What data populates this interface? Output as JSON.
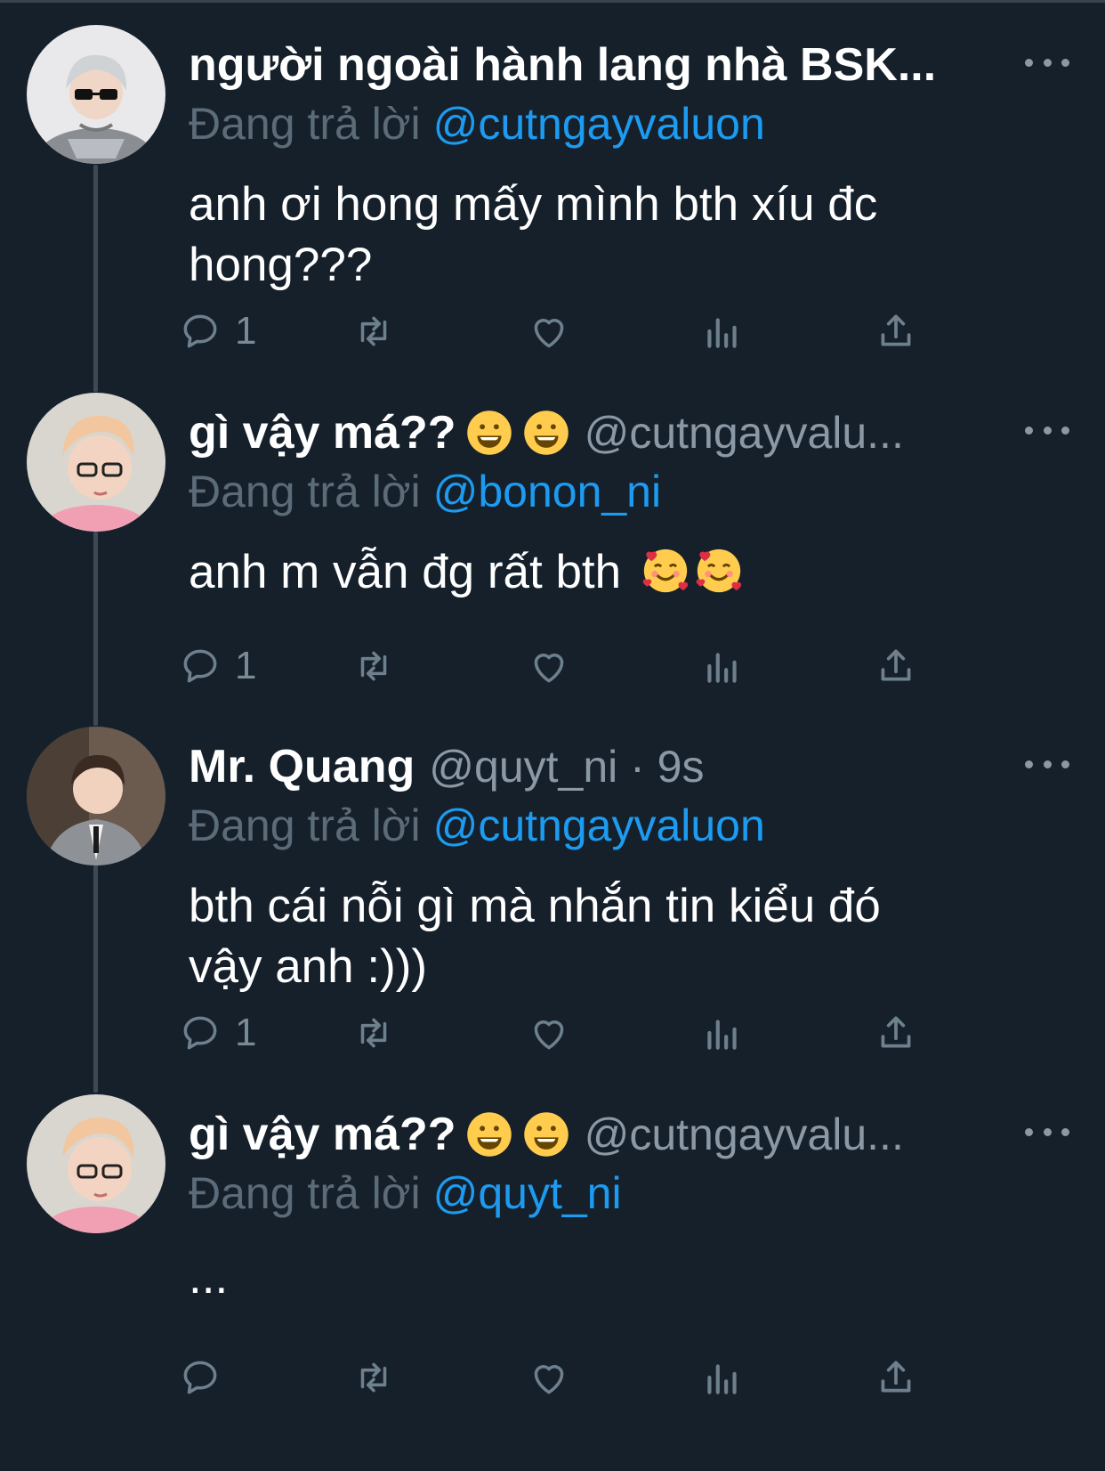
{
  "colors": {
    "background": "#15202b",
    "name": "#ffffff",
    "muted": "#8b98a5",
    "link": "#1d9bf0",
    "thread_line": "#3d4a55"
  },
  "tweets": [
    {
      "name": "người ngoài hành lang nhà BSK...",
      "handle": "",
      "replying_prefix": "Đang trả lời",
      "mention": "@cutngayvaluon",
      "body_lines": [
        "anh ơi hong mấy mình bth xíu đc",
        "hong???"
      ],
      "reply_count": "1",
      "avatar": "avatar-blonde-sunglasses"
    },
    {
      "name": "gì vậy má??",
      "handle": "@cutngayvalu...",
      "replying_prefix": "Đang trả lời",
      "mention": "@bonon_ni",
      "body_lines": [
        "anh m vẫn đg rất bth"
      ],
      "reply_count": "1",
      "avatar": "avatar-pink-hair-glasses"
    },
    {
      "name": "Mr. Quang",
      "handle": "@quyt_ni · 9s",
      "replying_prefix": "Đang trả lời",
      "mention": "@cutngayvaluon",
      "body_lines": [
        "bth cái nỗi gì mà nhắn tin kiểu đó",
        "vậy anh :)))"
      ],
      "reply_count": "1",
      "avatar": "avatar-suit"
    },
    {
      "name": "gì vậy má??",
      "handle": "@cutngayvalu...",
      "replying_prefix": "Đang trả lời",
      "mention": "@quyt_ni",
      "body_lines": [
        "..."
      ],
      "reply_count": "",
      "avatar": "avatar-pink-hair-glasses"
    }
  ]
}
